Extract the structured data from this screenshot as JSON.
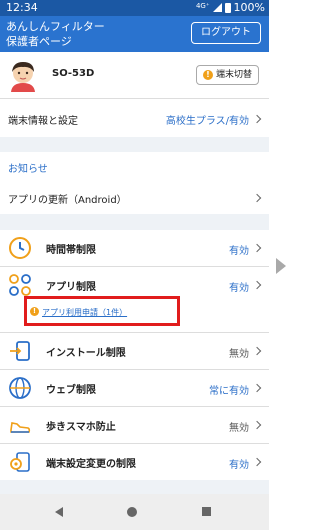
{
  "status_bar": {
    "time": "12:34",
    "signal": "4G⁺",
    "battery": "100%"
  },
  "header": {
    "title": "あんしんフィルター\n保護者ページ",
    "logout_label": "ログアウト"
  },
  "device": {
    "name": "SO-53D",
    "switch_label": "端末切替",
    "warn_mark": "!"
  },
  "device_settings": {
    "label": "端末情報と設定",
    "value": "高校生プラス/有効"
  },
  "news": {
    "heading": "お知らせ",
    "item": "アプリの更新（Android）"
  },
  "menu": {
    "time_limit": {
      "label": "時間帯制限",
      "status": "有効"
    },
    "app_limit": {
      "label": "アプリ制限",
      "status": "有効"
    },
    "request": {
      "label": "アプリ利用申請（1件）",
      "mark": "!"
    },
    "install_limit": {
      "label": "インストール制限",
      "status": "無効"
    },
    "web_limit": {
      "label": "ウェブ制限",
      "status": "常に有効"
    },
    "walk_phone": {
      "label": "歩きスマホ防止",
      "status": "無効"
    },
    "settings_change": {
      "label": "端末設定変更の制限",
      "status": "有効"
    }
  },
  "icons": [
    "clock-icon",
    "apps-grid-icon",
    "install-icon",
    "globe-icon",
    "sneaker-icon",
    "settings-lock-icon"
  ],
  "colors": {
    "header": "#2a73cf",
    "status_bar": "#1b58a4",
    "accent": "#2a6ec8",
    "highlight": "#e11c1c",
    "warn": "#f0a01a"
  }
}
